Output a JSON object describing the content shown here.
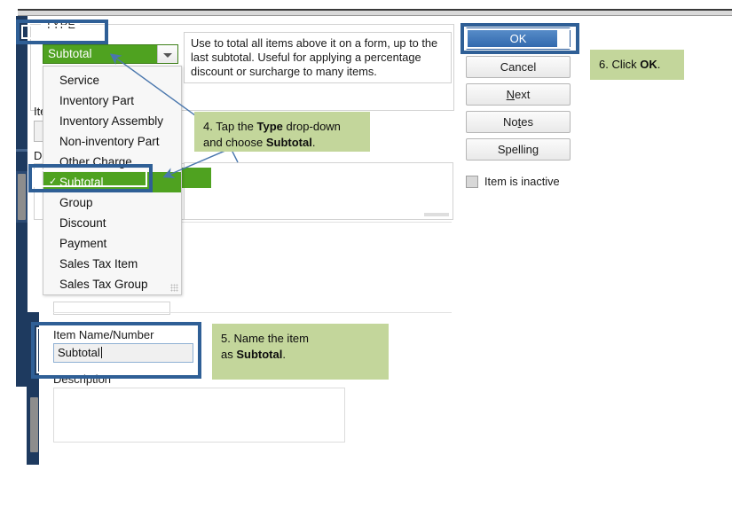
{
  "window": {
    "type_group_legend": "TYPE",
    "type_combo_value": "Subtotal",
    "type_help_text": "Use to total all items above it on a form, up to the last subtotal. Useful for applying a percentage discount or surcharge to many items.",
    "dropdown_options": [
      "Service",
      "Inventory Part",
      "Inventory Assembly",
      "Non-inventory Part",
      "Other Charge",
      "Subtotal",
      "Group",
      "Discount",
      "Payment",
      "Sales Tax Item",
      "Sales Tax Group"
    ],
    "selected_option": "Subtotal",
    "selected_check_glyph": "✓",
    "dropdown_arrow_icon": "chevron-down-icon",
    "resize_grip_icon": "resize-grip-icon"
  },
  "fields": {
    "item_name_label_clipped": "Ite",
    "description_label_clipped": "De",
    "item_name_label": "Item Name/Number",
    "item_name_value": "Subtotal",
    "description_label": "Description",
    "description_value": ""
  },
  "buttons": {
    "ok": "OK",
    "cancel": "Cancel",
    "next_pre": "N",
    "next_mnemonic": "N",
    "next_rest": "ext",
    "notes_a": "No",
    "notes_mnemonic": "t",
    "notes_b": "es",
    "spelling_a": "Spellin",
    "spelling_mnemonic": "g"
  },
  "checkbox": {
    "inactive_label": "Item is inactive",
    "checked": false
  },
  "annotations": [
    {
      "id": "callout-4",
      "parts": [
        "4. Tap the ",
        "Type",
        " drop-down and choose ",
        "Subtotal",
        "."
      ]
    },
    {
      "id": "callout-5",
      "parts": [
        "5. Name the item as ",
        "Subtotal",
        "."
      ]
    },
    {
      "id": "callout-6",
      "parts": [
        "6. Click ",
        "OK",
        "."
      ]
    }
  ],
  "callout4": {
    "t1": "4. Tap the ",
    "b1": "Type",
    "t2": " drop-down",
    "t3": "and choose ",
    "b2": "Subtotal",
    "t4": "."
  },
  "callout5": {
    "t1": "5. Name the item",
    "t2": "as ",
    "b1": "Subtotal",
    "t3": "."
  },
  "callout6": {
    "t1": "6. Click ",
    "b1": "OK",
    "t2": "."
  },
  "colors": {
    "highlight_blue": "#2f5f96",
    "callout_green": "#c3d69b",
    "select_green": "#4fa220",
    "ok_blue": "#2f66ab",
    "navy_strip": "#1e3a5f",
    "arrow_blue": "#4a77ad"
  }
}
